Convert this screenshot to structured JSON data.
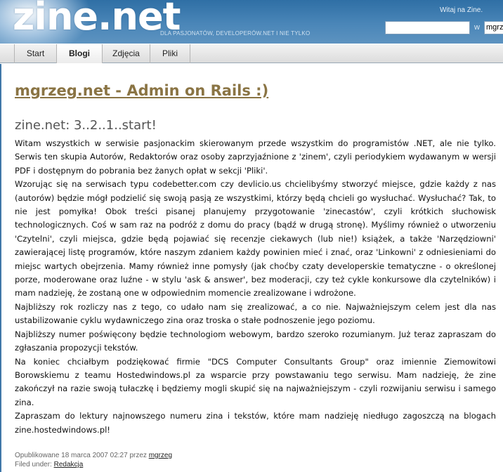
{
  "header": {
    "logo": "zine.net",
    "tagline": "DLA PASJONATÓW, DEVELOPERÓW.NET I NIE TYLKO",
    "welcome": "Witaj na Zine.",
    "search_value": "",
    "in_label": "w",
    "scope_value": "mgrzeg"
  },
  "nav": {
    "items": [
      {
        "label": "Start"
      },
      {
        "label": "Blogi"
      },
      {
        "label": "Zdjęcia"
      },
      {
        "label": "Pliki"
      }
    ],
    "active_index": 1
  },
  "blog": {
    "title": "mgrzeg.net - Admin on Rails :)"
  },
  "post": {
    "title": "zine.net: 3..2..1..start!",
    "paragraphs": [
      "Witam wszystkich w serwisie pasjonackim skierowanym przede wszystkim do programistów .NET, ale nie tylko. Serwis ten skupia Autorów, Redaktorów oraz osoby zaprzyjaźnione z 'zinem', czyli periodykiem wydawanym w wersji PDF i dostępnym do pobrania bez żanych opłat w sekcji 'Pliki'.",
      "Wzorując się na serwisach typu codebetter.com czy devlicio.us chcielibyśmy stworzyć miejsce, gdzie każdy z nas (autorów) będzie mógł podzielić się swoją pasją ze wszystkimi, którzy będą chcieli go wysłuchać. Wysłuchać? Tak, to nie jest pomyłka! Obok treści pisanej planujemy przygotowanie 'zinecastów', czyli krótkich słuchowisk technologicznych. Coś w sam raz na podróż z domu do pracy (bądź w drugą stronę). Myślimy również o utworzeniu 'Czytelni', czyli miejsca, gdzie będą pojawiać się recenzje ciekawych (lub nie!) książek, a także 'Narzędziowni' zawierającej listę programów, które naszym zdaniem każdy powinien mieć i znać, oraz 'Linkowni' z odniesieniami do miejsc wartych obejrzenia. Mamy również inne pomysły (jak choćby czaty developerskie tematyczne - o określonej porze, moderowane oraz luźne - w stylu 'ask & answer', bez moderacji, czy też cykle konkursowe dla czytelników) i mam nadzieję, że zostaną one w odpowiednim momencie zrealizowane i wdrożone.",
      "Najbliższy rok rozliczy nas z tego, co udało nam się zrealizować, a co nie. Najważniejszym celem jest dla nas ustabilizowanie cyklu wydawniczego zina oraz troska o stałe podnoszenie jego poziomu.",
      "Najbliższy numer poświęcony będzie technologiom webowym, bardzo szeroko rozumianym. Już teraz zapraszam do zgłaszania propozycji tekstów.",
      "Na koniec chciałbym podziękować firmie \"DCS Computer Consultants Group\" oraz imiennie Ziemowitowi Borowskiemu z teamu Hostedwindows.pl za wsparcie przy powstawaniu tego serwisu. Mam nadzieję, że zine zakończył na razie swoją tułaczkę i będziemy mogli skupić się na najważniejszym - czyli rozwijaniu serwisu i samego zina.",
      "Zapraszam do lektury najnowszego numeru zina i tekstów, które mam nadzieję niedługo zagoszczą na blogach zine.hostedwindows.pl!"
    ],
    "meta": {
      "published_prefix": "Opublikowane 18 marca 2007 02:27 przez",
      "author": "mgrzeg",
      "filed_prefix": "Filed under:",
      "category": "Redakcja"
    }
  },
  "colors": {
    "header_blue": "#4a86b8",
    "blog_title": "#8a7444",
    "page_border": "#3f77a8"
  }
}
